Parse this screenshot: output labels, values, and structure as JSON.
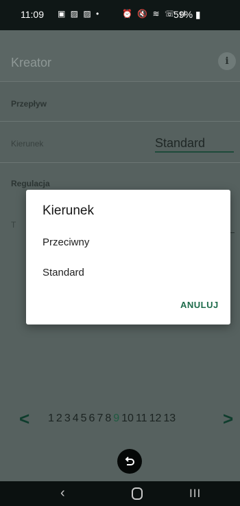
{
  "status": {
    "time": "11:09",
    "left_icons": "▣ ▨ ▨ •",
    "right_icons": "⏰ 🔇 ≋ ☏ ıl",
    "battery": "59%"
  },
  "appbar": {
    "title": "Kreator",
    "info_glyph": "i"
  },
  "sections": {
    "flow": "Przepływ",
    "direction_label": "Kierunek",
    "direction_value": "Standard",
    "regulation": "Regulacja",
    "row2_label_fragment": "T"
  },
  "dialog": {
    "title": "Kierunek",
    "options": [
      "Przeciwny",
      "Standard"
    ],
    "cancel": "ANULUJ"
  },
  "pager": {
    "prev": "<",
    "next": ">",
    "pages": [
      "1",
      "2",
      "3",
      "4",
      "5",
      "6",
      "7",
      "8",
      "9",
      "10",
      "11",
      "12",
      "13"
    ],
    "active_page": "9"
  },
  "navbar": {
    "back": "‹",
    "recent": "III"
  },
  "colors": {
    "accent": "#1d6b4a",
    "overlay_bg": "#56615f",
    "dialog_bg": "#ffffff"
  }
}
